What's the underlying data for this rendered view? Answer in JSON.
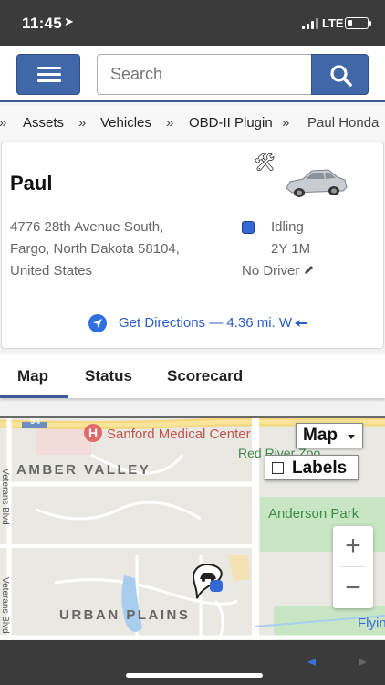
{
  "status_bar": {
    "time": "11:45",
    "network": "LTE"
  },
  "header": {
    "search_placeholder": "Search"
  },
  "breadcrumb": {
    "items": [
      "Assets",
      "Vehicles",
      "OBD-II Plugin",
      "Paul Honda"
    ]
  },
  "vehicle": {
    "name": "Paul",
    "address_lines": [
      "4776 28th Avenue South,",
      "Fargo, North Dakota 58104,",
      "United States"
    ],
    "status": "Idling",
    "duration": "2Y 1M",
    "driver": "No Driver",
    "status_color": "#3369d6",
    "directions": "Get Directions — 4.36 mi. W"
  },
  "tabs": {
    "items": [
      "Map",
      "Status",
      "Scorecard"
    ],
    "active": "Map"
  },
  "map": {
    "highway": "94",
    "map_type": "Map",
    "labels_toggle": "Labels",
    "labels_checked": false,
    "zoom_in": "+",
    "zoom_out": "−",
    "places": {
      "hospital": "Sanford Medical Center",
      "zoo": "Red River Zoo",
      "park": "Anderson Park",
      "amber": "AMBER VALLEY",
      "urban": "URBAN PLAINS",
      "veterans_top": "Veterans Blvd",
      "veterans_bottom": "Veterans Blvd",
      "flyin": "Flyin"
    }
  }
}
